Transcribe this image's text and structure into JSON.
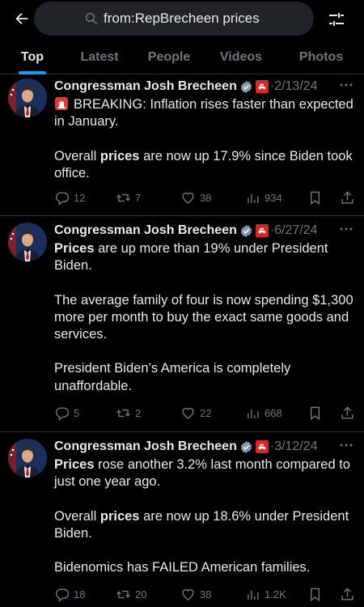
{
  "search": {
    "query": "from:RepBrecheen prices"
  },
  "tabs": [
    {
      "label": "Top",
      "active": true
    },
    {
      "label": "Latest",
      "active": false
    },
    {
      "label": "People",
      "active": false
    },
    {
      "label": "Videos",
      "active": false
    },
    {
      "label": "Photos",
      "active": false
    }
  ],
  "colors": {
    "accent": "#1d9bf0",
    "text": "#e7e9ea",
    "muted": "#71767b",
    "divider": "#2f3336",
    "badge_red": "#d62828"
  },
  "tweets": [
    {
      "name": "Congressman Josh Brecheen",
      "separator": "·",
      "date": "2/13/24",
      "line1": "BREAKING: Inflation rises faster than expected in January.",
      "p2_pre": "Overall ",
      "p2_bold": "prices",
      "p2_post": " are now up 17.9% since Biden took office.",
      "stats": {
        "replies": "12",
        "reposts": "7",
        "likes": "38",
        "views": "934"
      }
    },
    {
      "name": "Congressman Josh Brecheen",
      "separator": "·",
      "date": "6/27/24",
      "p1_bold": "Prices",
      "p1_post": " are up more than 19% under President Biden.",
      "p2": "The average family of four is now spending $1,300 more per month to buy the exact same goods and services.",
      "p3": "President Biden’s America is completely unaffordable.",
      "stats": {
        "replies": "5",
        "reposts": "2",
        "likes": "22",
        "views": "668"
      }
    },
    {
      "name": "Congressman Josh Brecheen",
      "separator": "·",
      "date": "3/12/24",
      "p1_bold": "Prices",
      "p1_post": " rose another 3.2% last month compared to just one year ago.",
      "p2_pre": "Overall ",
      "p2_bold": "prices",
      "p2_post": " are now up 18.6% under President Biden.",
      "p3": "Bidenomics has FAILED American families.",
      "stats": {
        "replies": "18",
        "reposts": "20",
        "likes": "38",
        "views": "1.2K"
      }
    }
  ]
}
